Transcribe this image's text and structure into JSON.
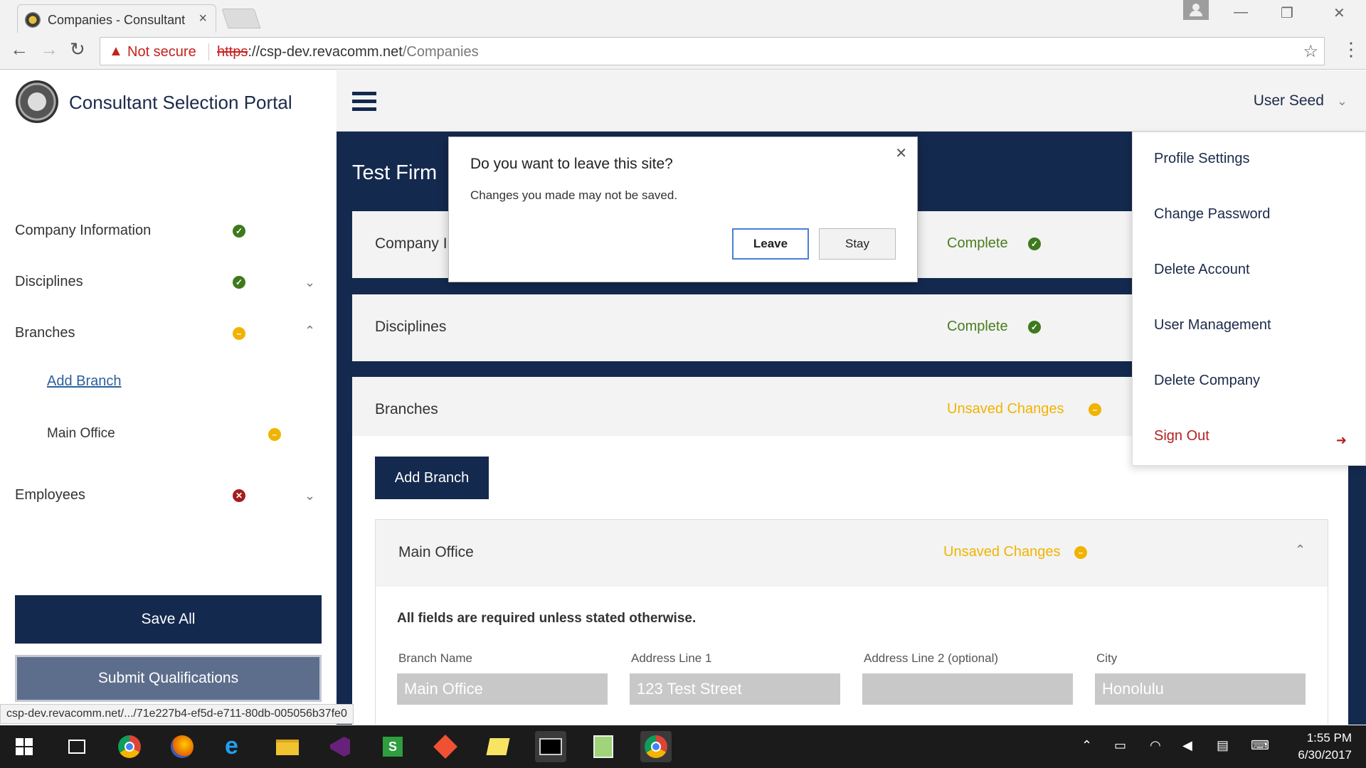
{
  "browser": {
    "tab_title": "Companies - Consultant",
    "tab_close": "×",
    "security_label": "Not secure",
    "url_scheme": "https",
    "url_sep": "://",
    "url_host": "csp-dev.revacomm.net",
    "url_path": "/Companies",
    "status_url": "csp-dev.revacomm.net/.../71e227b4-ef5d-e711-80db-005056b37fe0"
  },
  "sidebar": {
    "portal_title": "Consultant Selection Portal",
    "items": [
      {
        "label": "Company Information",
        "status": "complete"
      },
      {
        "label": "Disciplines",
        "status": "complete"
      },
      {
        "label": "Branches",
        "status": "warning"
      },
      {
        "label": "Employees",
        "status": "error"
      }
    ],
    "sub_items": {
      "add_branch": "Add Branch",
      "main_office": "Main Office"
    },
    "save_all": "Save All",
    "submit": "Submit Qualifications"
  },
  "header": {
    "user_name": "User Seed"
  },
  "main": {
    "firm_name": "Test Firm",
    "panels": [
      {
        "title": "Company Information",
        "status": "Complete"
      },
      {
        "title": "Disciplines",
        "status": "Complete"
      },
      {
        "title": "Branches",
        "status": "Unsaved Changes"
      }
    ],
    "add_branch_button": "Add Branch",
    "branch": {
      "title": "Main Office",
      "status": "Unsaved Changes",
      "required_note": "All fields are required unless stated otherwise.",
      "fields": [
        {
          "label": "Branch Name",
          "value": "Main Office"
        },
        {
          "label": "Address Line 1",
          "value": "123 Test Street"
        },
        {
          "label": "Address Line 2 (optional)",
          "value": ""
        },
        {
          "label": "City",
          "value": "Honolulu"
        }
      ]
    }
  },
  "user_dropdown": {
    "items": [
      "Profile Settings",
      "Change Password",
      "Delete Account",
      "User Management",
      "Delete Company",
      "Sign Out"
    ]
  },
  "modal": {
    "title": "Do you want to leave this site?",
    "message": "Changes you made may not be saved.",
    "leave": "Leave",
    "stay": "Stay"
  },
  "taskbar": {
    "time": "1:55 PM",
    "date": "6/30/2017"
  },
  "colors": {
    "navy": "#14294e",
    "complete_green": "#4a7d1f",
    "unsaved_amber": "#f0b400",
    "error_red": "#a51c1c"
  }
}
